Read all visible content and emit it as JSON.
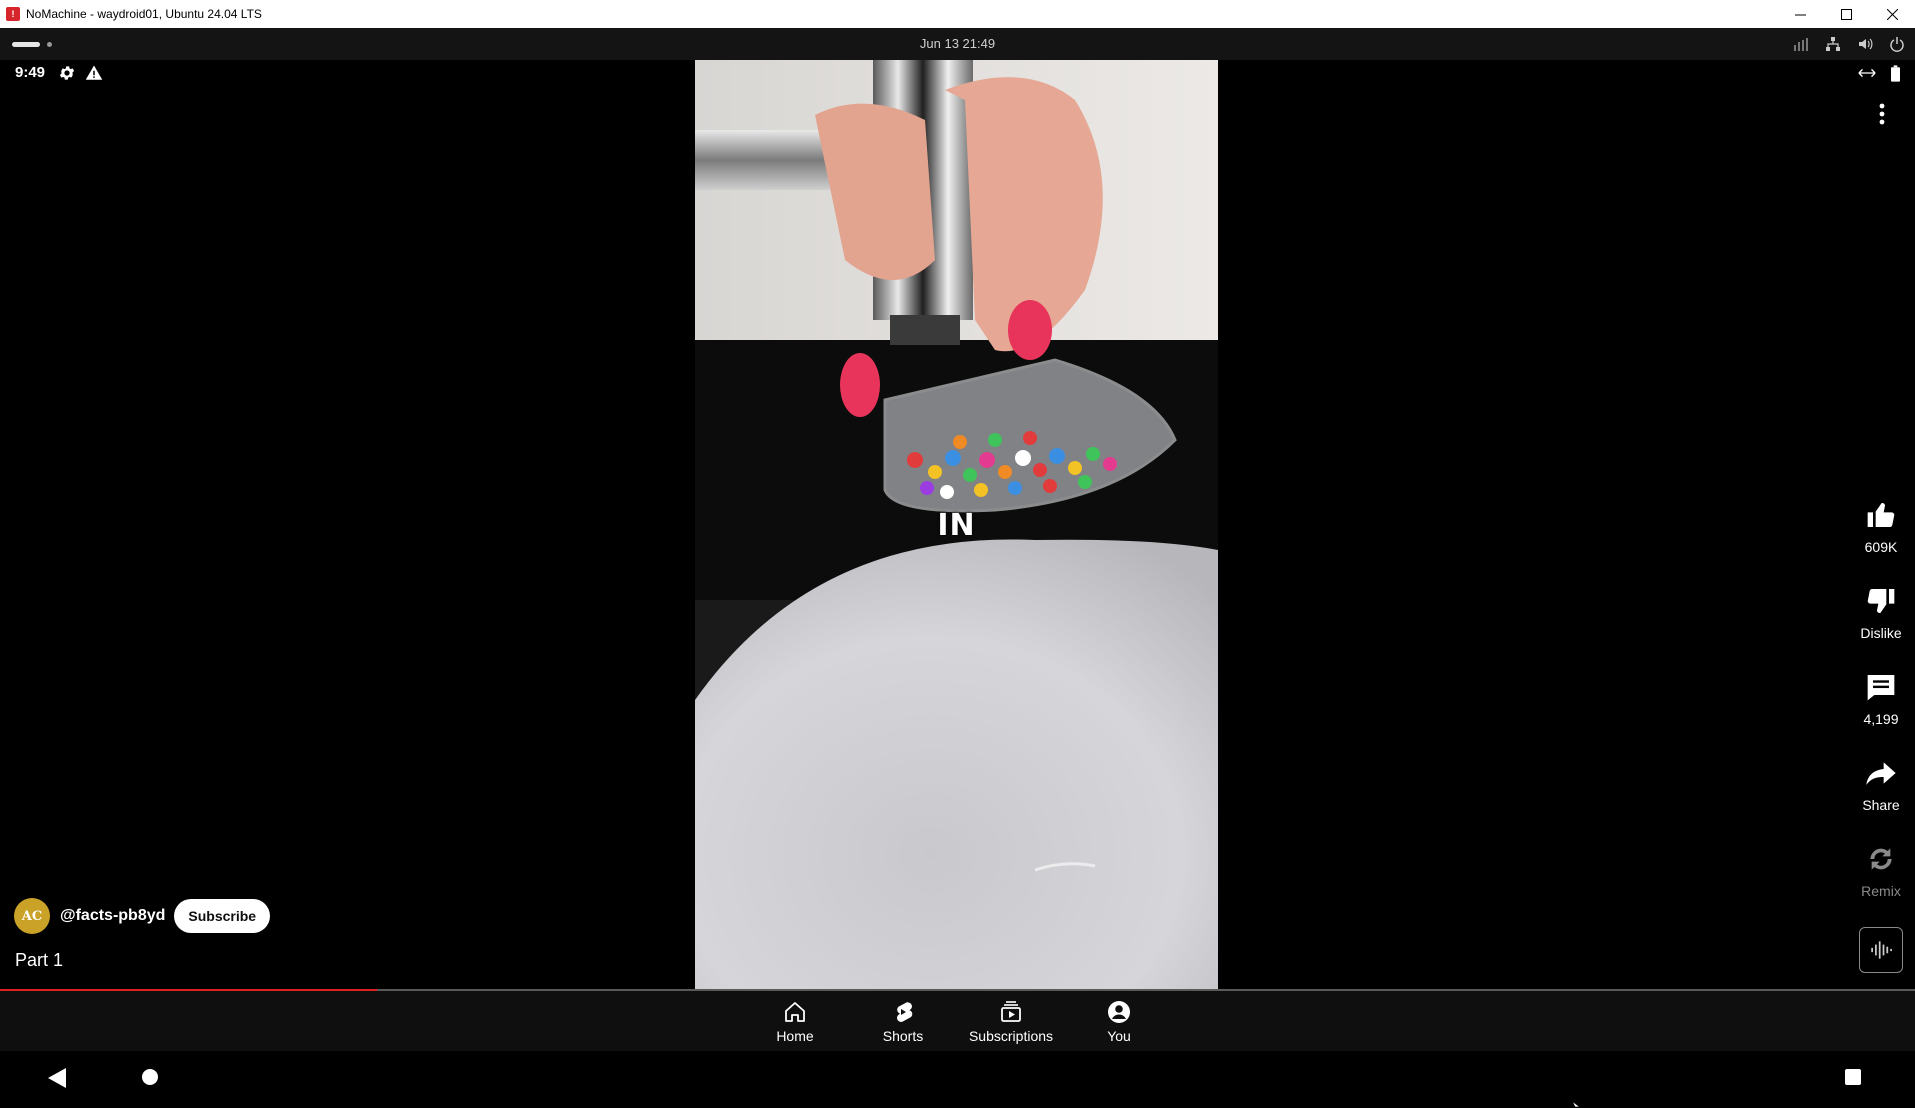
{
  "window": {
    "title": "NoMachine - waydroid01, Ubuntu 24.04 LTS",
    "app_icon": "nomachine-icon",
    "controls": [
      "minimize-icon",
      "maximize-icon",
      "close-icon"
    ]
  },
  "nomachine_bar": {
    "datetime": "Jun 13  21:49",
    "icons": [
      "signal-bars-icon",
      "network-icon",
      "speaker-icon",
      "power-icon"
    ]
  },
  "status_bar": {
    "time": "9:49",
    "icons_left": [
      "gear-icon",
      "warning-icon"
    ],
    "icons_right": [
      "resize-arrows-icon",
      "battery-icon"
    ]
  },
  "video": {
    "caption": "IN"
  },
  "actions": {
    "like": {
      "label": "609K",
      "icon": "thumbs-up-icon"
    },
    "dislike": {
      "label": "Dislike",
      "icon": "thumbs-down-icon"
    },
    "comments": {
      "label": "4,199",
      "icon": "comment-icon"
    },
    "share": {
      "label": "Share",
      "icon": "share-icon"
    },
    "remix": {
      "label": "Remix",
      "icon": "remix-icon"
    },
    "sound": {
      "icon": "audio-waveform-icon"
    }
  },
  "channel": {
    "avatar_text": "AC",
    "name": "@facts-pb8yd",
    "subscribe_label": "Subscribe"
  },
  "video_title": "Part 1",
  "progress": {
    "fraction": 0.197
  },
  "bottom_nav": {
    "items": [
      {
        "label": "Home",
        "icon": "home-icon"
      },
      {
        "label": "Shorts",
        "icon": "shorts-icon"
      },
      {
        "label": "Subscriptions",
        "icon": "subscriptions-icon"
      },
      {
        "label": "You",
        "icon": "account-icon"
      }
    ]
  },
  "system_nav": [
    "back-icon",
    "home-circle-icon",
    "recents-icon"
  ],
  "colors": {
    "accent_red": "#e0201c",
    "background": "#000000",
    "nav_background": "#0f0f0f"
  }
}
